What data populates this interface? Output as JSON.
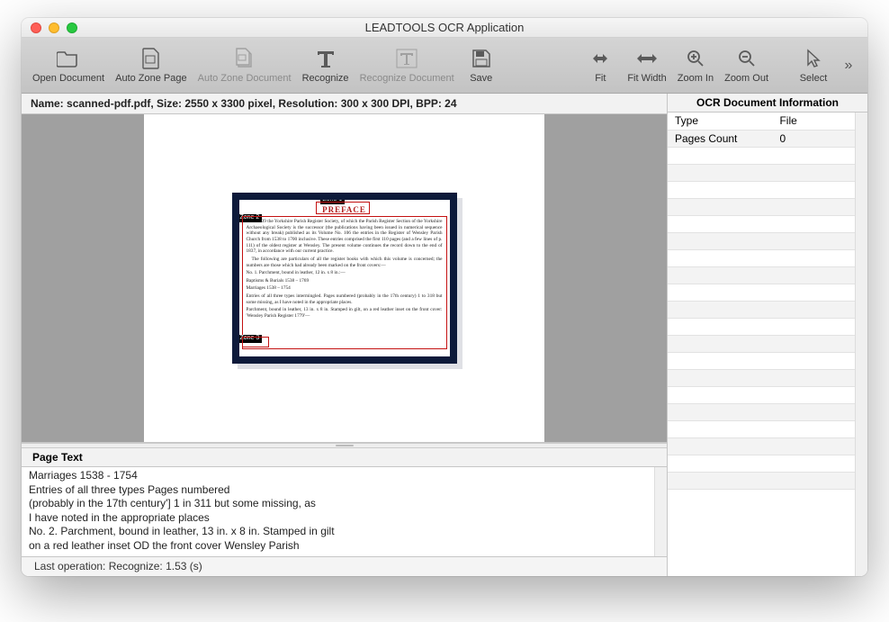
{
  "window": {
    "title": "LEADTOOLS OCR Application"
  },
  "toolbar": {
    "open_document": "Open Document",
    "auto_zone_page": "Auto Zone Page",
    "auto_zone_document": "Auto Zone Document",
    "recognize": "Recognize",
    "recognize_document": "Recognize Document",
    "save": "Save",
    "fit": "Fit",
    "fit_width": "Fit Width",
    "zoom_in": "Zoom In",
    "zoom_out": "Zoom Out",
    "select": "Select",
    "overflow": "»"
  },
  "infobar": "Name: scanned-pdf.pdf, Size: 2550 x 3300 pixel, Resolution: 300 x 300 DPI, BPP: 24",
  "document_preview": {
    "zone_labels": {
      "z1": "Zone 1",
      "z2": "Zone 2",
      "z3": "Zone 3"
    },
    "preface_heading": "PREFACE",
    "body_lines": [
      "In 1939 the Yorkshire Parish Register Society, of which the Parish Register Section of the Yorkshire Archaeological Society is the successor (the publications having been issued in numerical sequence without any break) published as its Volume No. 106 the entries in the Register of Wensley Parish Church from 1538 to 1700 inclusive. These entries comprised the first 110 pages (and a few lines of p. 111) of the oldest register at Wensley. The present volume continues the record down to the end of 1837, in accordance with our current practice.",
      "The following are particulars of all the register books with which this volume is concerned; the numbers are those which had already been marked on the front covers:—",
      "No. 1.  Parchment, bound in leather, 12 in. x 8 in.:—",
      "          Baptisms & Burials 1538 – 1769",
      "          Marriages            1538 – 1754",
      "Entries of all three types intermingled. Pages numbered (probably in the 17th century) 1 to 318 but some missing, as I have noted in the appropriate places.",
      "Parchment, bound in leather, 13 in. x 8 in. Stamped in gilt, on a red leather inset on the front cover: 'Wensley Parish Register 1779'—"
    ]
  },
  "page_text": {
    "header": "Page Text",
    "lines": [
      "Marriages 1538 - 1754",
      "Entries of all three types Pages numbered",
      "(probably in the 17th century'] 1 in 311 but some missing, as",
      "I have noted in the appropriate places",
      "No. 2. Parchment, bound in leather, 13 in. x 8 in. Stamped in gilt",
      "on a red leather inset OD the front cover Wensley Parish"
    ]
  },
  "statusbar": "Last operation: Recognize: 1.53 (s)",
  "right_panel": {
    "header": "OCR Document Information",
    "rows": [
      {
        "key": "Type",
        "value": "File"
      },
      {
        "key": "Pages Count",
        "value": "0"
      }
    ]
  }
}
